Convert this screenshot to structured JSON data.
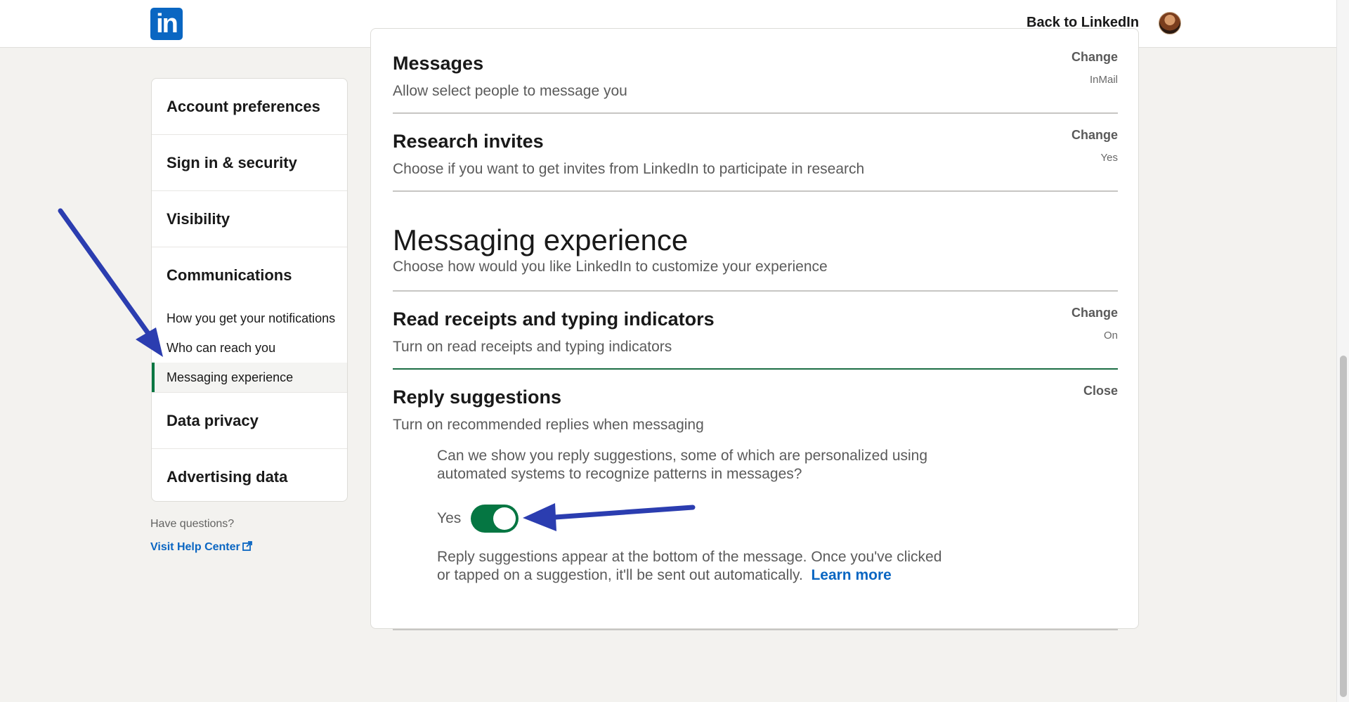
{
  "topbar": {
    "logo_text": "in",
    "back_link": "Back to LinkedIn"
  },
  "sidebar": {
    "sections": [
      {
        "label": "Account preferences"
      },
      {
        "label": "Sign in & security"
      },
      {
        "label": "Visibility"
      }
    ],
    "communications": {
      "label": "Communications",
      "items": [
        {
          "label": "How you get your notifications"
        },
        {
          "label": "Who can reach you"
        },
        {
          "label": "Messaging experience",
          "active": true
        }
      ]
    },
    "after_sections": [
      {
        "label": "Data privacy"
      },
      {
        "label": "Advertising data"
      }
    ],
    "questions": "Have questions?",
    "help_link": "Visit Help Center"
  },
  "main": {
    "messages": {
      "title": "Messages",
      "desc": "Allow select people to message you",
      "action": "Change",
      "value": "InMail"
    },
    "research": {
      "title": "Research invites",
      "desc": "Choose if you want to get invites from LinkedIn to participate in research",
      "action": "Change",
      "value": "Yes"
    },
    "section": {
      "title": "Messaging experience",
      "desc": "Choose how would you like LinkedIn to customize your experience"
    },
    "read_receipts": {
      "title": "Read receipts and typing indicators",
      "desc": "Turn on read receipts and typing indicators",
      "action": "Change",
      "value": "On"
    },
    "reply_suggestions": {
      "title": "Reply suggestions",
      "desc": "Turn on recommended replies when messaging",
      "action": "Close",
      "question": "Can we show you reply suggestions, some of which are personalized using automated systems to recognize patterns in messages?",
      "toggle_label": "Yes",
      "toggle_on": true,
      "info": "Reply suggestions appear at the bottom of the message. Once you've clicked or tapped on a suggestion, it'll be sent out automatically.",
      "learn_more": "Learn more"
    }
  },
  "colors": {
    "brand": "#0a66c2",
    "toggle_on": "#057642",
    "annotation_arrow": "#2b3db0"
  }
}
